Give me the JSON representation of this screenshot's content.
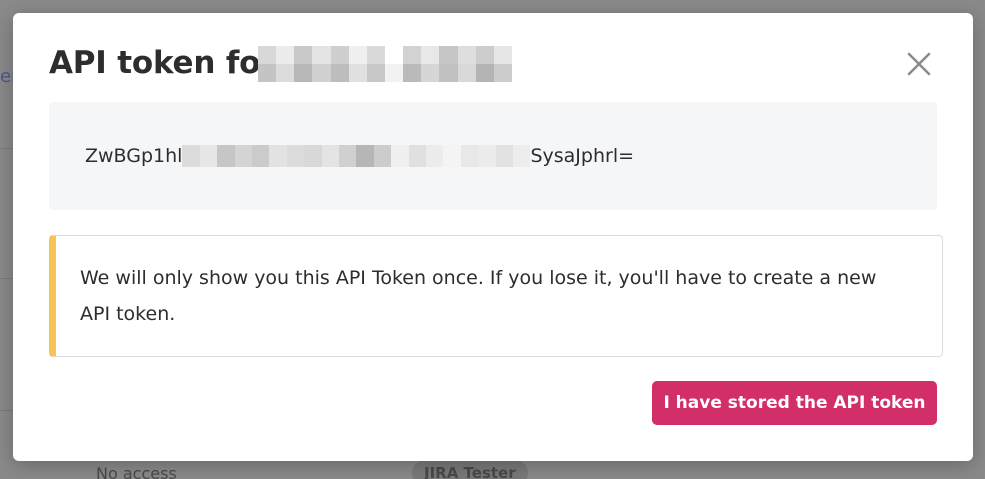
{
  "background": {
    "link_fragment": "er",
    "bottom_text": "No access",
    "bottom_badge": "JIRA Tester"
  },
  "modal": {
    "title": "API token for",
    "close_icon": "close-icon",
    "token": {
      "prefix": "ZwBGp1hl",
      "suffix": "SysaJphrl="
    },
    "warning": {
      "text": "We will only show you this API Token once. If you lose it, you'll have to create a new API token.",
      "accent_color": "#f6c356"
    },
    "primary_button": {
      "label": "I have stored the API token",
      "color": "#d12e6a"
    }
  }
}
